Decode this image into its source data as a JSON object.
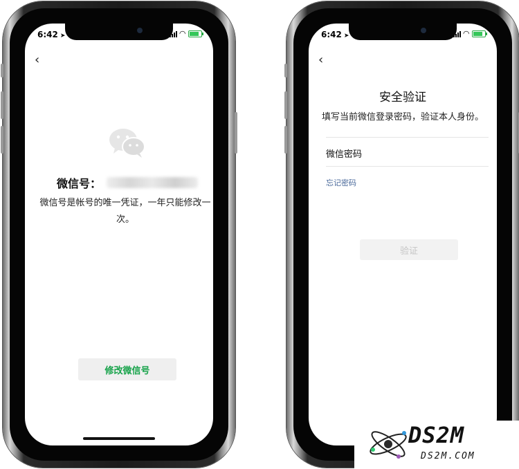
{
  "status_bar": {
    "time": "6:42",
    "location_arrow": "➤"
  },
  "left_screen": {
    "back_icon": "‹",
    "wechat_id_label": "微信号：",
    "description": "微信号是帐号的唯一凭证，一年只能修改一次。",
    "modify_button_label": "修改微信号"
  },
  "right_screen": {
    "back_icon": "‹",
    "title": "安全验证",
    "description": "填写当前微信登录密码，验证本人身份。",
    "password_field_label": "微信密码",
    "forgot_password_link": "忘记密码",
    "verify_button_label": "验证"
  },
  "watermark": {
    "brand": "DS2M",
    "domain": "DS2M.COM"
  },
  "colors": {
    "accent_green": "#17a34a",
    "link_blue": "#4b6a9b",
    "disabled_text": "#c5c5c5",
    "button_bg": "#efefef"
  }
}
